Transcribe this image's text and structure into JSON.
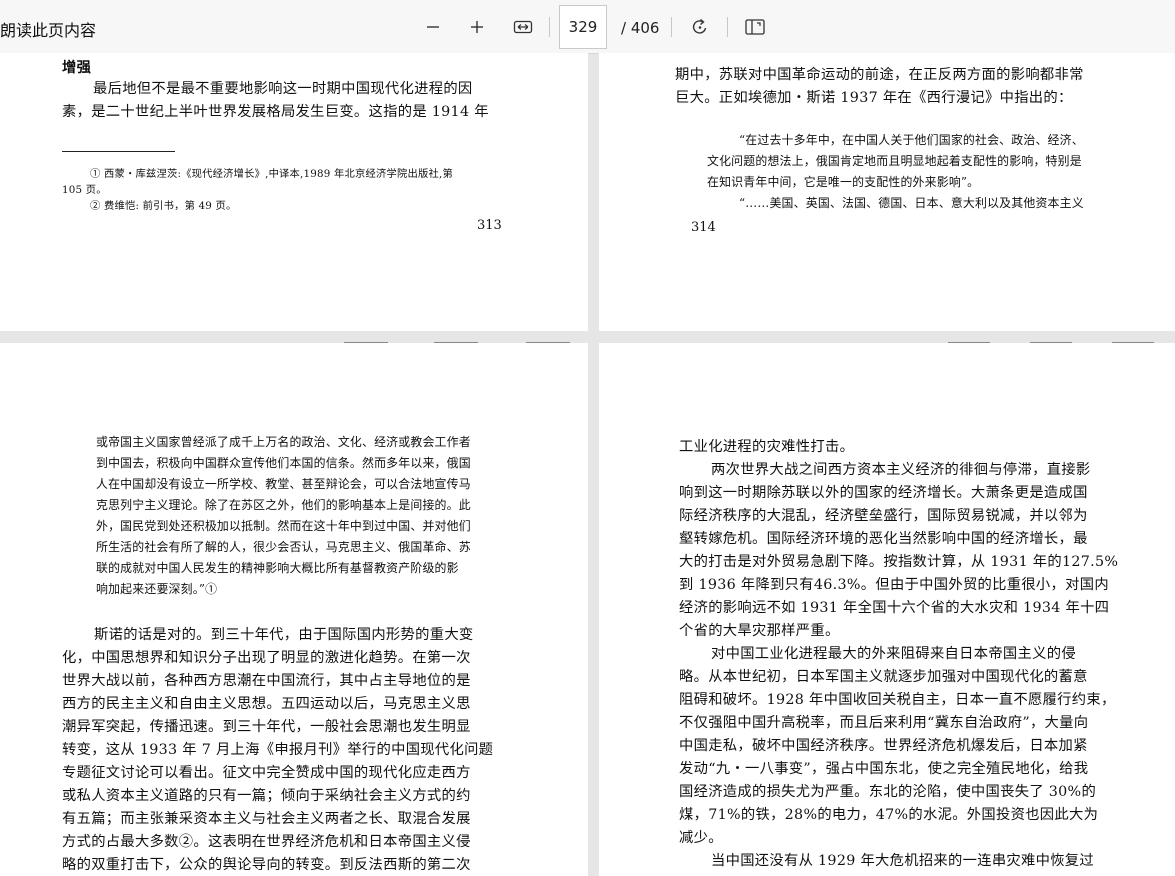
{
  "toolbar": {
    "read_aloud": "朗读此页内容",
    "current_page": "329",
    "total_pages": "/ 406",
    "zoom_out_icon": "minus-icon",
    "zoom_in_icon": "plus-icon",
    "fit_icon": "fit-width-icon",
    "rotate_icon": "rotate-icon",
    "view_icon": "page-view-icon"
  },
  "page313": {
    "heading": "增强",
    "lines": [
      "最后地但不是最不重要地影响这一时期中国现代化进程的因",
      "素，是二十世纪上半叶世界发展格局发生巨变。这指的是 1914 年"
    ],
    "footnotes": [
      "①  西蒙・库兹涅茨:《现代经济增长》,中译本,1989 年北京经济学院出版社,第",
      "105 页。",
      "②  费维恺: 前引书，第 49 页。"
    ],
    "page_number": "313"
  },
  "page314": {
    "lines": [
      "期中，苏联对中国革命运动的前途，在正反两方面的影响都非常",
      "巨大。正如埃德加・斯诺 1937 年在《西行漫记》中指出的："
    ],
    "quote": [
      "“在过去十多年中，在中国人关于他们国家的社会、政治、经济、",
      "文化问题的想法上，俄国肯定地而且明显地起着支配性的影响，特别是",
      "在知识青年中间，它是唯一的支配性的外来影响”。",
      "“……美国、英国、法国、德国、日本、意大利以及其他资本主义"
    ],
    "page_number": "314"
  },
  "page315": {
    "quote": [
      "或帝国主义国家曾经派了成千上万名的政治、文化、经济或教会工作者",
      "到中国去，积极向中国群众宣传他们本国的信条。然而多年以来，俄国",
      "人在中国却没有设立一所学校、教堂、甚至辩论会，可以合法地宣传马",
      "克思列宁主义理论。除了在苏区之外，他们的影响基本上是间接的。此",
      "外，国民党到处还积极加以抵制。然而在这十年中到过中国、并对他们",
      "所生活的社会有所了解的人，很少会否认，马克思主义、俄国革命、苏",
      "联的成就对中国人民发生的精神影响大概比所有基督教资产阶级的影",
      "响加起来还要深刻。”①"
    ],
    "body": [
      "斯诺的话是对的。到三十年代，由于国际国内形势的重大变",
      "化，中国思想界和知识分子出现了明显的激进化趋势。在第一次",
      "世界大战以前，各种西方思潮在中国流行，其中占主导地位的是",
      "西方的民主主义和自由主义思想。五四运动以后，马克思主义思",
      "潮异军突起，传播迅速。到三十年代，一般社会思潮也发生明显",
      "转变，这从 1933 年 7 月上海《申报月刊》举行的中国现代化问题",
      "专题征文讨论可以看出。征文中完全赞成中国的现代化应走西方",
      "或私人资本主义道路的只有一篇；倾向于采纳社会主义方式的约",
      "有五篇；而主张兼采资本主义与社会主义两者之长、取混合发展",
      "方式的占最大多数②。这表明在世界经济危机和日本帝国主义侵",
      "略的双重打击下，公众的舆论导向的转变。到反法西斯的第二次"
    ]
  },
  "page316": {
    "body": [
      "工业化进程的灾难性打击。",
      "两次世界大战之间西方资本主义经济的徘徊与停滞，直接影",
      "响到这一时期除苏联以外的国家的经济增长。大萧条更是造成国",
      "际经济秩序的大混乱，经济壁垒盛行，国际贸易锐减，并以邻为",
      "壑转嫁危机。国际经济环境的恶化当然影响中国的经济增长，最",
      "大的打击是对外贸易急剧下降。按指数计算，从 1931 年的127.5%",
      "到 1936 年降到只有46.3%。但由于中国外贸的比重很小，对国内",
      "经济的影响远不如 1931 年全国十六个省的大水灾和 1934 年十四",
      "个省的大旱灾那样严重。",
      "对中国工业化进程最大的外来阻碍来自日本帝国主义的侵",
      "略。从本世纪初，日本军国主义就逐步加强对中国现代化的蓄意",
      "阻碍和破坏。1928 年中国收回关税自主，日本一直不愿履行约束，",
      "不仅强阻中国升高税率，而且后来利用“冀东自治政府”，大量向",
      "中国走私，破坏中国经济秩序。世界经济危机爆发后，日本加紧",
      "发动“九・一八事变”，强占中国东北，使之完全殖民地化，给我",
      "国经济造成的损失尤为严重。东北的沦陷，使中国丧失了 30%的",
      "煤，71%的铁，28%的电力，47%的水泥。外国投资也因此大为",
      "减少。",
      "当中国还没有从 1929 年大危机招来的一连串灾难中恢复过"
    ]
  }
}
